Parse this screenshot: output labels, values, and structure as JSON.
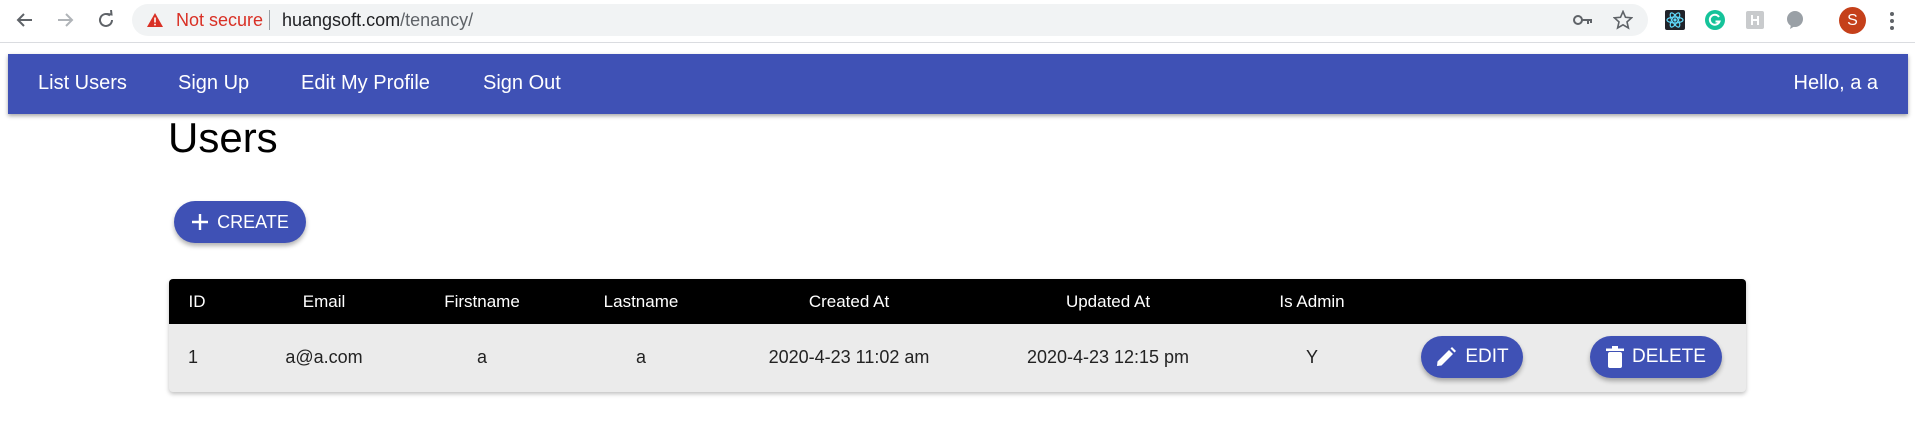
{
  "browser": {
    "security_label": "Not secure",
    "url_host": "huangsoft.com",
    "url_path": "/tenancy/",
    "profile_initial": "S"
  },
  "appbar": {
    "links": [
      "List Users",
      "Sign Up",
      "Edit My Profile",
      "Sign Out"
    ],
    "greeting": "Hello, a a"
  },
  "page": {
    "title": "Users",
    "create_label": "CREATE"
  },
  "table": {
    "columns": [
      "ID",
      "Email",
      "Firstname",
      "Lastname",
      "Created At",
      "Updated At",
      "Is Admin"
    ],
    "rows": [
      {
        "id": "1",
        "email": "a@a.com",
        "firstname": "a",
        "lastname": "a",
        "created_at": "2020-4-23 11:02 am",
        "updated_at": "2020-4-23 12:15 pm",
        "is_admin": "Y",
        "edit_label": "EDIT",
        "delete_label": "DELETE"
      }
    ]
  },
  "colors": {
    "primary": "#3f51b5",
    "table_header": "#000000",
    "row_bg": "#ebebeb",
    "warning": "#d93025"
  }
}
